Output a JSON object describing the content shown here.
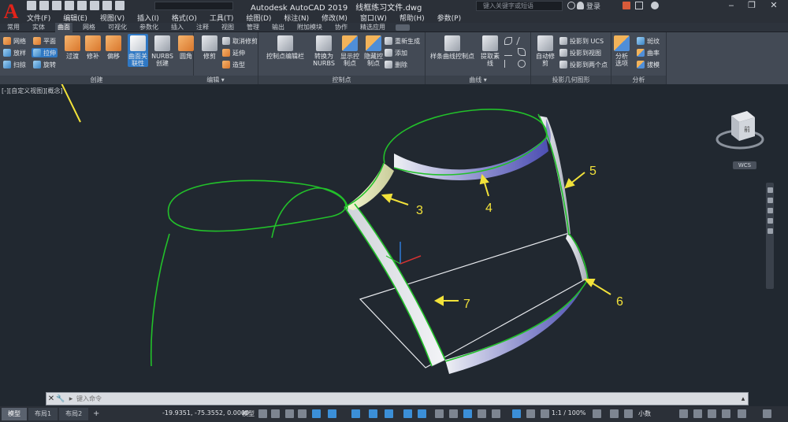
{
  "window": {
    "app_title": "Autodesk AutoCAD 2019",
    "file_name": "线框练习文件.dwg",
    "search_placeholder": "键入关键字或短语",
    "login_label": "登录",
    "app_logo": "A"
  },
  "menu": [
    "文件(F)",
    "编辑(E)",
    "视图(V)",
    "插入(I)",
    "格式(O)",
    "工具(T)",
    "绘图(D)",
    "标注(N)",
    "修改(M)",
    "窗口(W)",
    "帮助(H)",
    "参数(P)"
  ],
  "ribbon_tabs": [
    "常用",
    "实体",
    "曲面",
    "网格",
    "可视化",
    "参数化",
    "插入",
    "注释",
    "视图",
    "管理",
    "输出",
    "附加模块",
    "协作",
    "精选应用"
  ],
  "active_ribbon_tab": "曲面",
  "panels": {
    "create": {
      "title": "创建",
      "small_buttons": [
        "网络",
        "平面",
        "放样",
        "拉伸",
        "扫掠",
        "旋转"
      ],
      "large_buttons": [
        "过渡",
        "修补",
        "偏移",
        "曲面关联性",
        "NURBS创建"
      ]
    },
    "edit": {
      "title": "编辑 ▾",
      "large_buttons": [
        "圆角",
        "修剪"
      ],
      "small_buttons": [
        "取消修剪",
        "延伸",
        "造型"
      ]
    },
    "control_points": {
      "title": "控制点",
      "large_buttons": [
        "控制点编辑栏",
        "转换为NURBS",
        "显示控制点",
        "隐藏控制点"
      ],
      "small_buttons": [
        "重新生成",
        "添加",
        "删除"
      ]
    },
    "curves": {
      "title": "曲线 ▾",
      "large_buttons": [
        "样条曲线控制点",
        "提取素线"
      ]
    },
    "projection": {
      "title": "投影几何图形",
      "large_buttons": [
        "自动修剪"
      ],
      "small_buttons": [
        "投影到 UCS",
        "投影到视图",
        "投影到两个点"
      ]
    },
    "analysis": {
      "title": "分析",
      "large_buttons": [
        "分析选项"
      ],
      "small_buttons": [
        "斑纹",
        "曲率",
        "拔模"
      ]
    }
  },
  "viewport": {
    "label": "[-][自定义视图][概念]",
    "callouts": [
      "3",
      "4",
      "5",
      "6",
      "7"
    ],
    "wcs_label": "WCS",
    "viewcube_face": "前"
  },
  "command_line": {
    "placeholder": "键入命令"
  },
  "status_bar": {
    "layout_tabs": [
      "模型",
      "布局1",
      "布局2"
    ],
    "add_tab": "+",
    "coordinates": "-19.9351, -75.3552, 0.0000",
    "model_label": "模型",
    "scale": "1:1 / 100%",
    "units": "小数"
  },
  "colors": {
    "wireframe": "#22c02a",
    "surface_light": "#e6e9ef",
    "surface_blue": "#5555b8",
    "callout": "#f2e23a",
    "background": "#212830"
  }
}
